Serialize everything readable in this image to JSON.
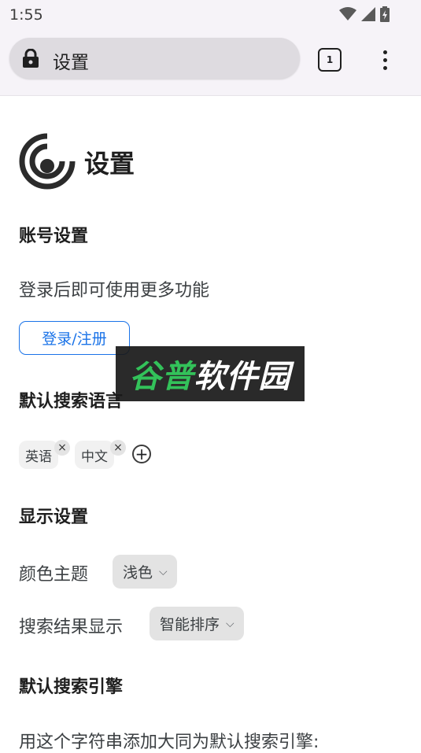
{
  "status": {
    "time": "1:55"
  },
  "toolbar": {
    "omnibox_text": "设置",
    "tab_count": "1"
  },
  "page": {
    "title": "设置",
    "account": {
      "title": "账号设置",
      "desc": "登录后即可使用更多功能",
      "login_button": "登录/注册"
    },
    "watermark": {
      "part1": "谷普",
      "part2": "软件园"
    },
    "language": {
      "title": "默认搜索语言",
      "chips": [
        "英语",
        "中文"
      ],
      "remove_icon": "×",
      "add_icon": "+"
    },
    "display": {
      "title": "显示设置",
      "theme_label": "颜色主题",
      "theme_value": "浅色",
      "results_label": "搜索结果显示",
      "results_value": "智能排序",
      "chevron": "⌵"
    },
    "engine": {
      "title": "默认搜索引擎",
      "desc": "用这个字符串添加大同为默认搜索引擎:"
    }
  },
  "colors": {
    "accent": "#1a73e8",
    "watermark_green": "#33c25a"
  }
}
